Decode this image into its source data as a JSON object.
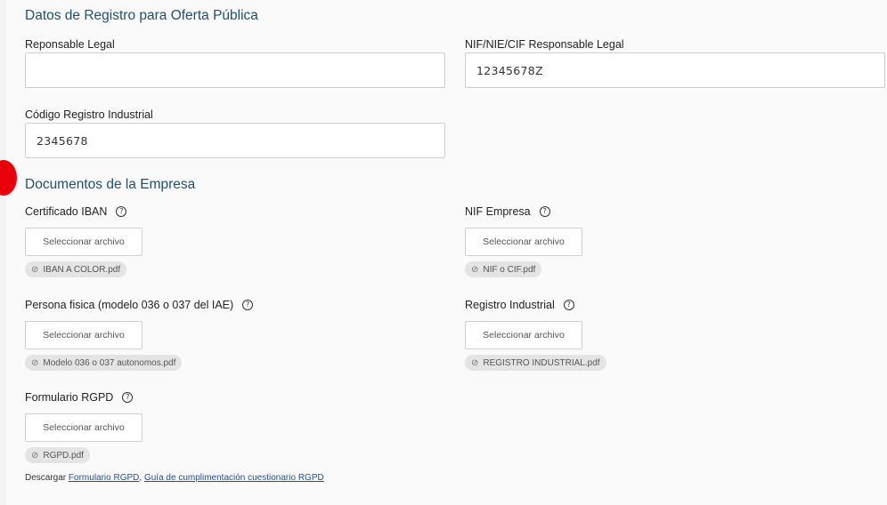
{
  "registro": {
    "title": "Datos de Registro para Oferta Pública",
    "responsable_label": "Reponsable Legal",
    "responsable_value": "",
    "nif_responsable_label": "NIF/NIE/CIF Responsable Legal",
    "nif_responsable_value": "12345678Z",
    "codigo_label": "Código Registro Industrial",
    "codigo_value": "2345678"
  },
  "documentos": {
    "title": "Documentos de la Empresa",
    "button_label": "Seleccionar archivo",
    "help_glyph": "?",
    "clip_glyph": "⊘",
    "certificado_iban": {
      "label": "Certificado IBAN",
      "file": "IBAN A COLOR.pdf"
    },
    "nif_empresa": {
      "label": "NIF Empresa",
      "file": "NIF o CIF.pdf"
    },
    "persona_fisica": {
      "label": "Persona fisica (modelo 036 o 037 del IAE)",
      "file": "Modelo 036 o 037 autonomos.pdf"
    },
    "registro_industrial": {
      "label": "Registro Industrial",
      "file": "REGISTRO INDUSTRIAL.pdf"
    },
    "formulario_rgpd": {
      "label": "Formulario RGPD",
      "file": "RGPD.pdf"
    }
  },
  "download": {
    "prefix": "Descargar",
    "link1": "Formulario RGPD",
    "separator": ",",
    "link2": "Guía de cumplimentación cuestionario RGPD"
  }
}
